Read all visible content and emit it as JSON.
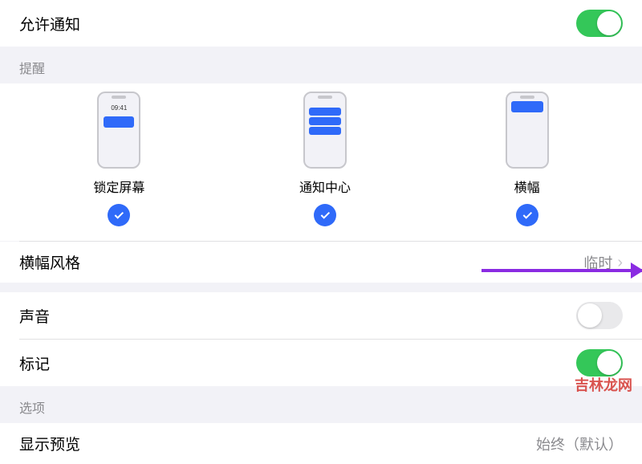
{
  "allow_notifications": {
    "label": "允许通知",
    "enabled": true
  },
  "alerts": {
    "header": "提醒",
    "lock_screen": {
      "label": "锁定屏幕",
      "time": "09:41",
      "checked": true
    },
    "notification_center": {
      "label": "通知中心",
      "checked": true
    },
    "banners": {
      "label": "横幅",
      "checked": true
    }
  },
  "banner_style": {
    "label": "横幅风格",
    "value": "临时"
  },
  "sound": {
    "label": "声音",
    "enabled": false
  },
  "badges": {
    "label": "标记",
    "enabled": true
  },
  "options_header": "选项",
  "show_preview": {
    "label": "显示预览",
    "value": "始终（默认）"
  },
  "watermark": "吉林龙网"
}
